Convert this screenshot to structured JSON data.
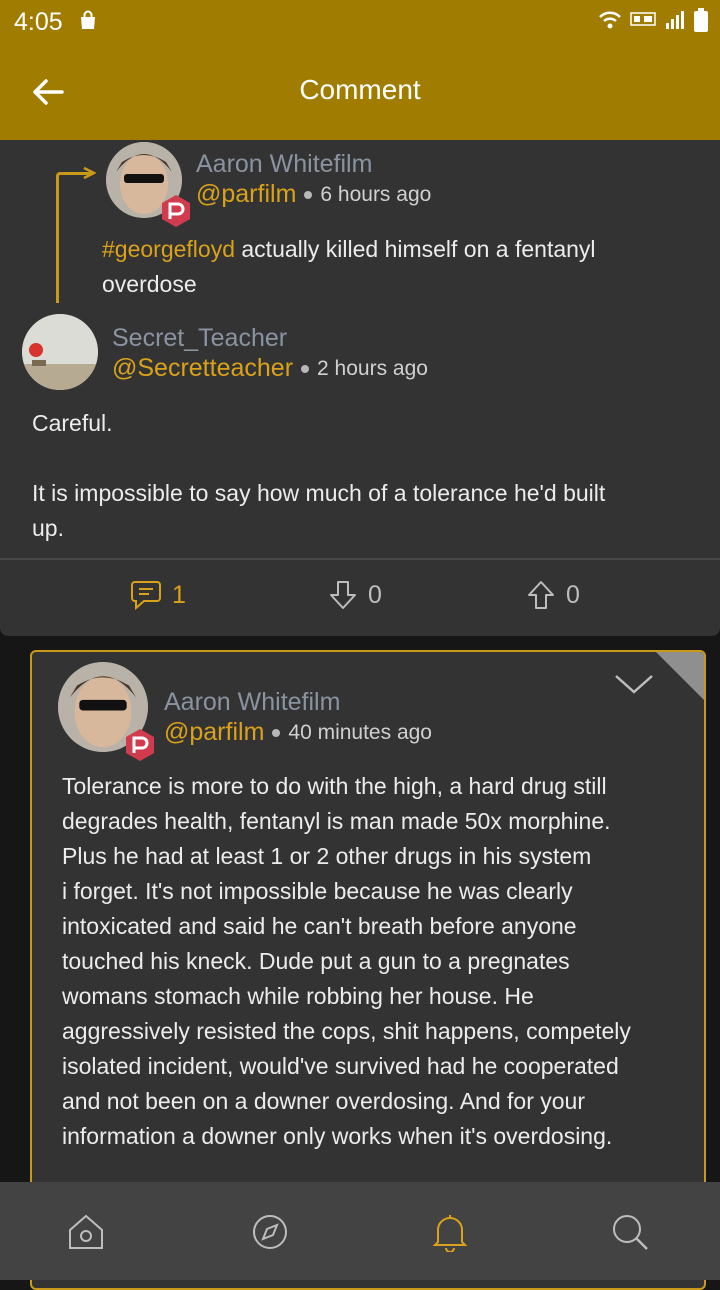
{
  "status_bar": {
    "time": "4:05"
  },
  "app_bar": {
    "title": "Comment"
  },
  "parent_comment": {
    "author_name": "Aaron Whitefilm",
    "handle": "@parfilm",
    "time_ago": "6 hours ago",
    "hashtag": "#georgefloyd",
    "text_line1": "actually killed himself on a fentanyl",
    "text_line2": "overdose"
  },
  "main_comment": {
    "author_name": "Secret_Teacher",
    "handle": "@Secretteacher",
    "time_ago": "2 hours ago",
    "paragraph1": "Careful.",
    "paragraph2_line1": "It is impossible to say how much of a tolerance he'd built",
    "paragraph2_line2": "up.",
    "comments_count": "1",
    "downvotes": "0",
    "upvotes": "0"
  },
  "reply_comment": {
    "author_name": "Aaron Whitefilm",
    "handle": "@parfilm",
    "time_ago": "40 minutes ago",
    "lines": [
      "Tolerance is more to do with the high, a hard drug still",
      "degrades health, fentanyl is man made 50x morphine.",
      "Plus he had at least 1 or 2 other drugs in his system",
      "i forget. It's not impossible because he was clearly",
      "intoxicated and said he can't breath before anyone",
      "touched his kneck. Dude put a gun to a pregnates",
      "womans stomach while robbing her house. He",
      "aggressively resisted the cops, shit happens, competely",
      "isolated incident, would've survived had he cooperated",
      "and not been on a downer overdosing. And for your",
      "information a downer only works when it's overdosing."
    ]
  },
  "colors": {
    "accent": "#a07c00",
    "handle": "#d9a21a",
    "card": "#333333",
    "background": "#161616",
    "nav": "#434343"
  },
  "bottom_nav": {
    "icons": [
      "home-icon",
      "compass-icon",
      "bell-icon",
      "search-icon"
    ],
    "active": "bell-icon"
  }
}
